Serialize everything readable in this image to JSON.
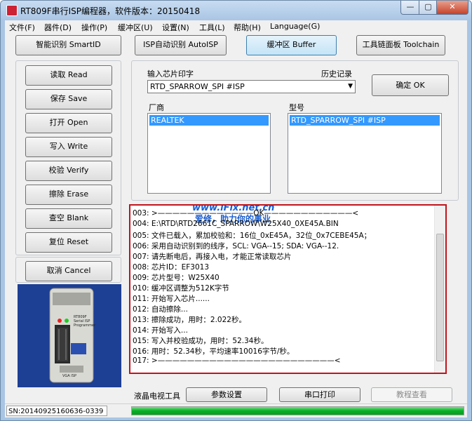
{
  "window": {
    "title": "RT809F串行ISP编程器，软件版本：20150418",
    "minimize": "—",
    "maximize": "▢",
    "close": "✕"
  },
  "menu": [
    "文件(F)",
    "器件(D)",
    "操作(P)",
    "缓冲区(U)",
    "设置(N)",
    "工具(L)",
    "帮助(H)",
    "Language(G)"
  ],
  "top_buttons": {
    "smart": "智能识别 SmartID",
    "autoisp": "ISP自动识别 AutoISP",
    "buffer": "缓冲区 Buffer",
    "toolchain": "工具链面板 Toolchain"
  },
  "side_buttons": {
    "read": "读取 Read",
    "save": "保存 Save",
    "open": "打开 Open",
    "write": "写入 Write",
    "verify": "校验 Verify",
    "erase": "擦除 Erase",
    "blank": "查空 Blank",
    "reset": "复位 Reset",
    "cancel": "取消 Cancel"
  },
  "chip": {
    "input_label": "输入芯片印字",
    "history_label": "历史记录",
    "value": "RTD_SPARROW_SPI #ISP",
    "ok_button": "确定 OK"
  },
  "vendor": {
    "label": "厂商",
    "selected": "REALTEK"
  },
  "model": {
    "label": "型号",
    "selected": "RTD_SPARROW_SPI #ISP"
  },
  "log": [
    "003: >—————————————OK————————————<",
    "004: E:\\RTD\\RTD2661C_SPARROW\\W25X40_0XE45A.BIN",
    "005: 文件已载入，累加校验和：16位_0xE45A，32位_0x7CEBE45A；",
    "006: 采用自动识别到的线序，SCL: VGA--15; SDA: VGA--12.",
    "007: 请先断电后，再接入电，才能正常读取芯片",
    "008: 芯片ID：EF3013",
    "009: 芯片型号：W25X40",
    "010: 缓冲区调整为512K字节",
    "011: 开始写入芯片......",
    "012: 自动擦除...",
    "013: 擦除成功，用时：2.022秒。",
    "014: 开始写入...",
    "015: 写入并校验成功，用时：52.34秒。",
    "016: 用时：52.34秒，平均速率10016字节/秒。",
    "017: >————————————————————————<"
  ],
  "watermark": {
    "url": "www.iFix.net.cn",
    "slogan": "爱修，助力你的事业"
  },
  "bottom": {
    "lcd_tool": "液晶电视工具",
    "params": "参数设置",
    "serial_print": "串口打印",
    "tutorial": "教程查看"
  },
  "status": {
    "sn": "SN:20140925160636-0339",
    "progress": 1.0
  },
  "photo": {
    "label_top": "RT809F Serial ISP Programmer",
    "label_bottom": "VGA ISP"
  },
  "colors": {
    "log_border": "#c0141c",
    "progress": "#06b025",
    "selection": "#3399ff"
  }
}
